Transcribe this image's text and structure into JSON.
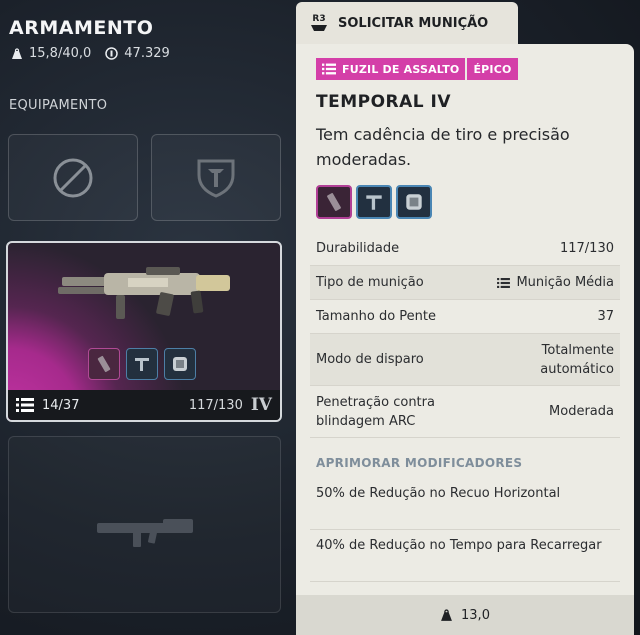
{
  "header": {
    "title": "ARMAMENTO",
    "weight": "15,8/40,0",
    "currency": "47.329"
  },
  "equipment": {
    "label": "EQUIPAMENTO"
  },
  "weapon_card": {
    "ammo": "14/37",
    "durability": "117/130",
    "tier": "IV"
  },
  "request_tab": {
    "button_hint": "R3",
    "label": "SOLICITAR MUNIÇÃO"
  },
  "tooltip": {
    "tags": [
      "FUZIL DE ASSALTO",
      "ÉPICO"
    ],
    "tag_color": "#d43fa8",
    "name": "TEMPORAL IV",
    "description": "Tem cadência de tiro e precisão moderadas.",
    "stats": [
      {
        "label": "Durabilidade",
        "value": "117/130"
      },
      {
        "label": "Tipo de munição",
        "value": "Munição Média"
      },
      {
        "label": "Tamanho do Pente",
        "value": "37"
      },
      {
        "label": "Modo de disparo",
        "value": "Totalmente automático"
      },
      {
        "label": "Penetração contra blindagem ARC",
        "value": "Moderada"
      }
    ],
    "upgrades_title": "APRIMORAR MODIFICADORES",
    "upgrades": [
      "50% de Redução no Recuo Horizontal",
      "40% de Redução no Tempo para Recarregar"
    ],
    "weight": "13,0"
  },
  "mod_icons": [
    "magazine-icon",
    "stock-icon",
    "grip-icon"
  ]
}
